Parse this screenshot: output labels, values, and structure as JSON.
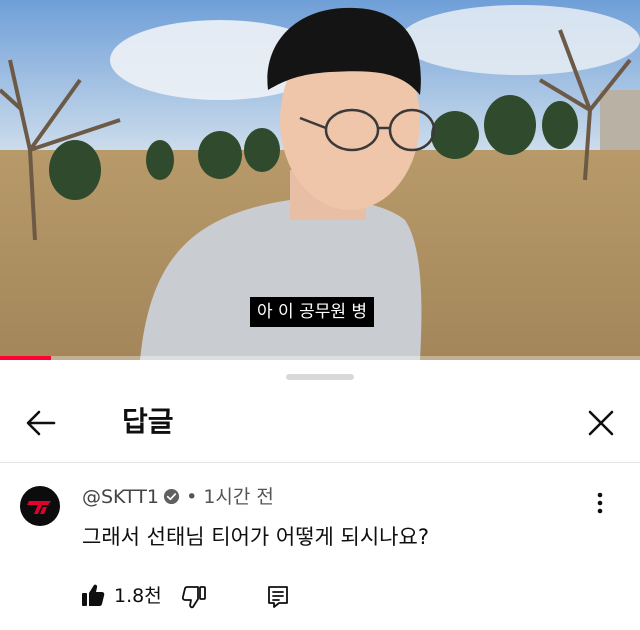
{
  "video": {
    "subtitle": "아 이 공무원 병",
    "progress_fraction": 0.08
  },
  "sheet": {
    "title": "답글"
  },
  "comment": {
    "handle": "@SKTT1",
    "separator": "•",
    "time": "1시간 전",
    "text": "그래서 선태님 티어가 어떻게 되시나요?",
    "likes": "1.8천"
  },
  "colors": {
    "accent": "#ff0033",
    "avatar_bg": "#0c0c0c",
    "avatar_logo": "#e2012d",
    "subtitle_bg": "#000000"
  },
  "icons": {
    "back": "arrow-left-icon",
    "close": "close-icon",
    "verified": "verified-check-icon",
    "more": "more-vertical-icon",
    "like": "thumbs-up-filled-icon",
    "dislike": "thumbs-down-icon",
    "reply": "reply-comment-icon"
  }
}
